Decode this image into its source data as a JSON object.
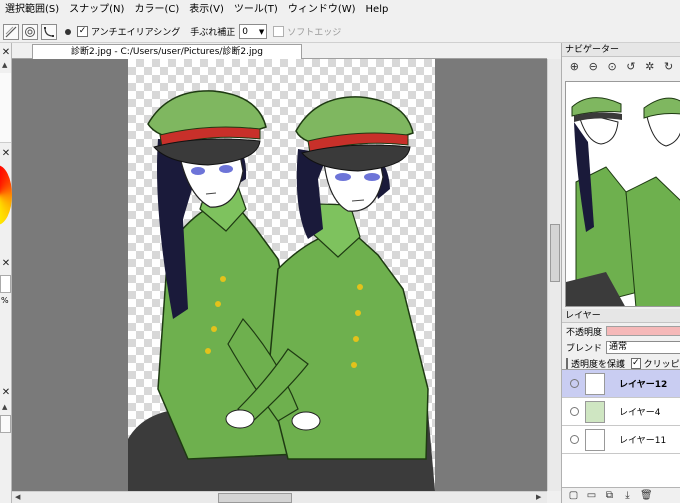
{
  "menu": [
    "選択範囲(S)",
    "スナップ(N)",
    "カラー(C)",
    "表示(V)",
    "ツール(T)",
    "ウィンドウ(W)",
    "Help"
  ],
  "toolbar": {
    "antialias_label": "アンチエイリアシング",
    "antialias_checked": "✓",
    "stabilizer_label": "手ぶれ補正",
    "stabilizer_value": "0",
    "soft_edge_label": "ソフトエッジ"
  },
  "document": {
    "tab_title": "診断2.jpg - C:/Users/user/Pictures/診断2.jpg"
  },
  "left_panel": {
    "percent_mark": "%"
  },
  "navigator": {
    "title": "ナビゲーター"
  },
  "layers": {
    "title": "レイヤー",
    "opacity_label": "不透明度",
    "blend_label": "ブレンド",
    "blend_value": "通常",
    "protect_alpha_label": "透明度を保護",
    "clipping_label": "クリッピング",
    "clipping_checked": "✓",
    "items": [
      {
        "name": "レイヤー12"
      },
      {
        "name": "レイヤー4"
      },
      {
        "name": "レイヤー11"
      }
    ]
  },
  "colors": {
    "cap_green": "#7fb760",
    "cap_band": "#c8302a",
    "uniform_green": "#6eb04e",
    "hair": "#1a1a3a",
    "layer_selected": "#c9cdf2",
    "opacity_fill": "#f5b8b8"
  }
}
